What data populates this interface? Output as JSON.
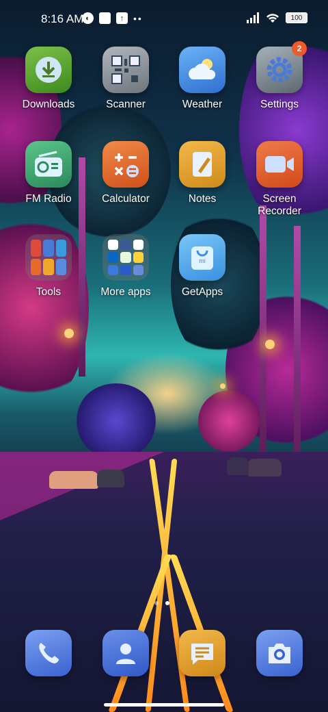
{
  "status_bar": {
    "time": "8:16 AM",
    "icons_left": [
      "vpn-icon",
      "blank-notification-icon",
      "upload-icon"
    ],
    "more": "••",
    "battery": "100"
  },
  "apps": {
    "downloads": {
      "label": "Downloads",
      "icon": "download-icon",
      "color": "#5a9a2a"
    },
    "scanner": {
      "label": "Scanner",
      "icon": "qr-code-icon",
      "color": "#8a8f96"
    },
    "weather": {
      "label": "Weather",
      "icon": "cloud-sun-icon",
      "color": "#3b86e0"
    },
    "settings": {
      "label": "Settings",
      "icon": "gear-icon",
      "color": "#7d8790",
      "badge": "2"
    },
    "fm_radio": {
      "label": "FM Radio",
      "icon": "radio-icon",
      "color": "#3fa06a"
    },
    "calculator": {
      "label": "Calculator",
      "icon": "calculator-icon",
      "color": "#e8692a"
    },
    "notes": {
      "label": "Notes",
      "icon": "notes-icon",
      "color": "#e8a52a"
    },
    "screen_recorder": {
      "label": "Screen\nRecorder",
      "icon": "video-camera-icon",
      "color": "#e8602a"
    },
    "tools": {
      "label": "Tools",
      "icon": "folder-icon"
    },
    "more_apps": {
      "label": "More apps",
      "icon": "folder-icon"
    },
    "getapps": {
      "label": "GetApps",
      "icon": "shopping-bag-icon",
      "color": "#4aa8e8"
    }
  },
  "page_indicator": {
    "count": 2,
    "active": 1
  },
  "dock": {
    "phone": {
      "icon": "phone-icon",
      "color": "#4a78e0"
    },
    "contacts": {
      "icon": "contacts-icon",
      "color": "#3a6ad0"
    },
    "messages": {
      "icon": "messages-icon",
      "color": "#e8a52a"
    },
    "camera": {
      "icon": "camera-icon",
      "color": "#4a78e0"
    }
  }
}
